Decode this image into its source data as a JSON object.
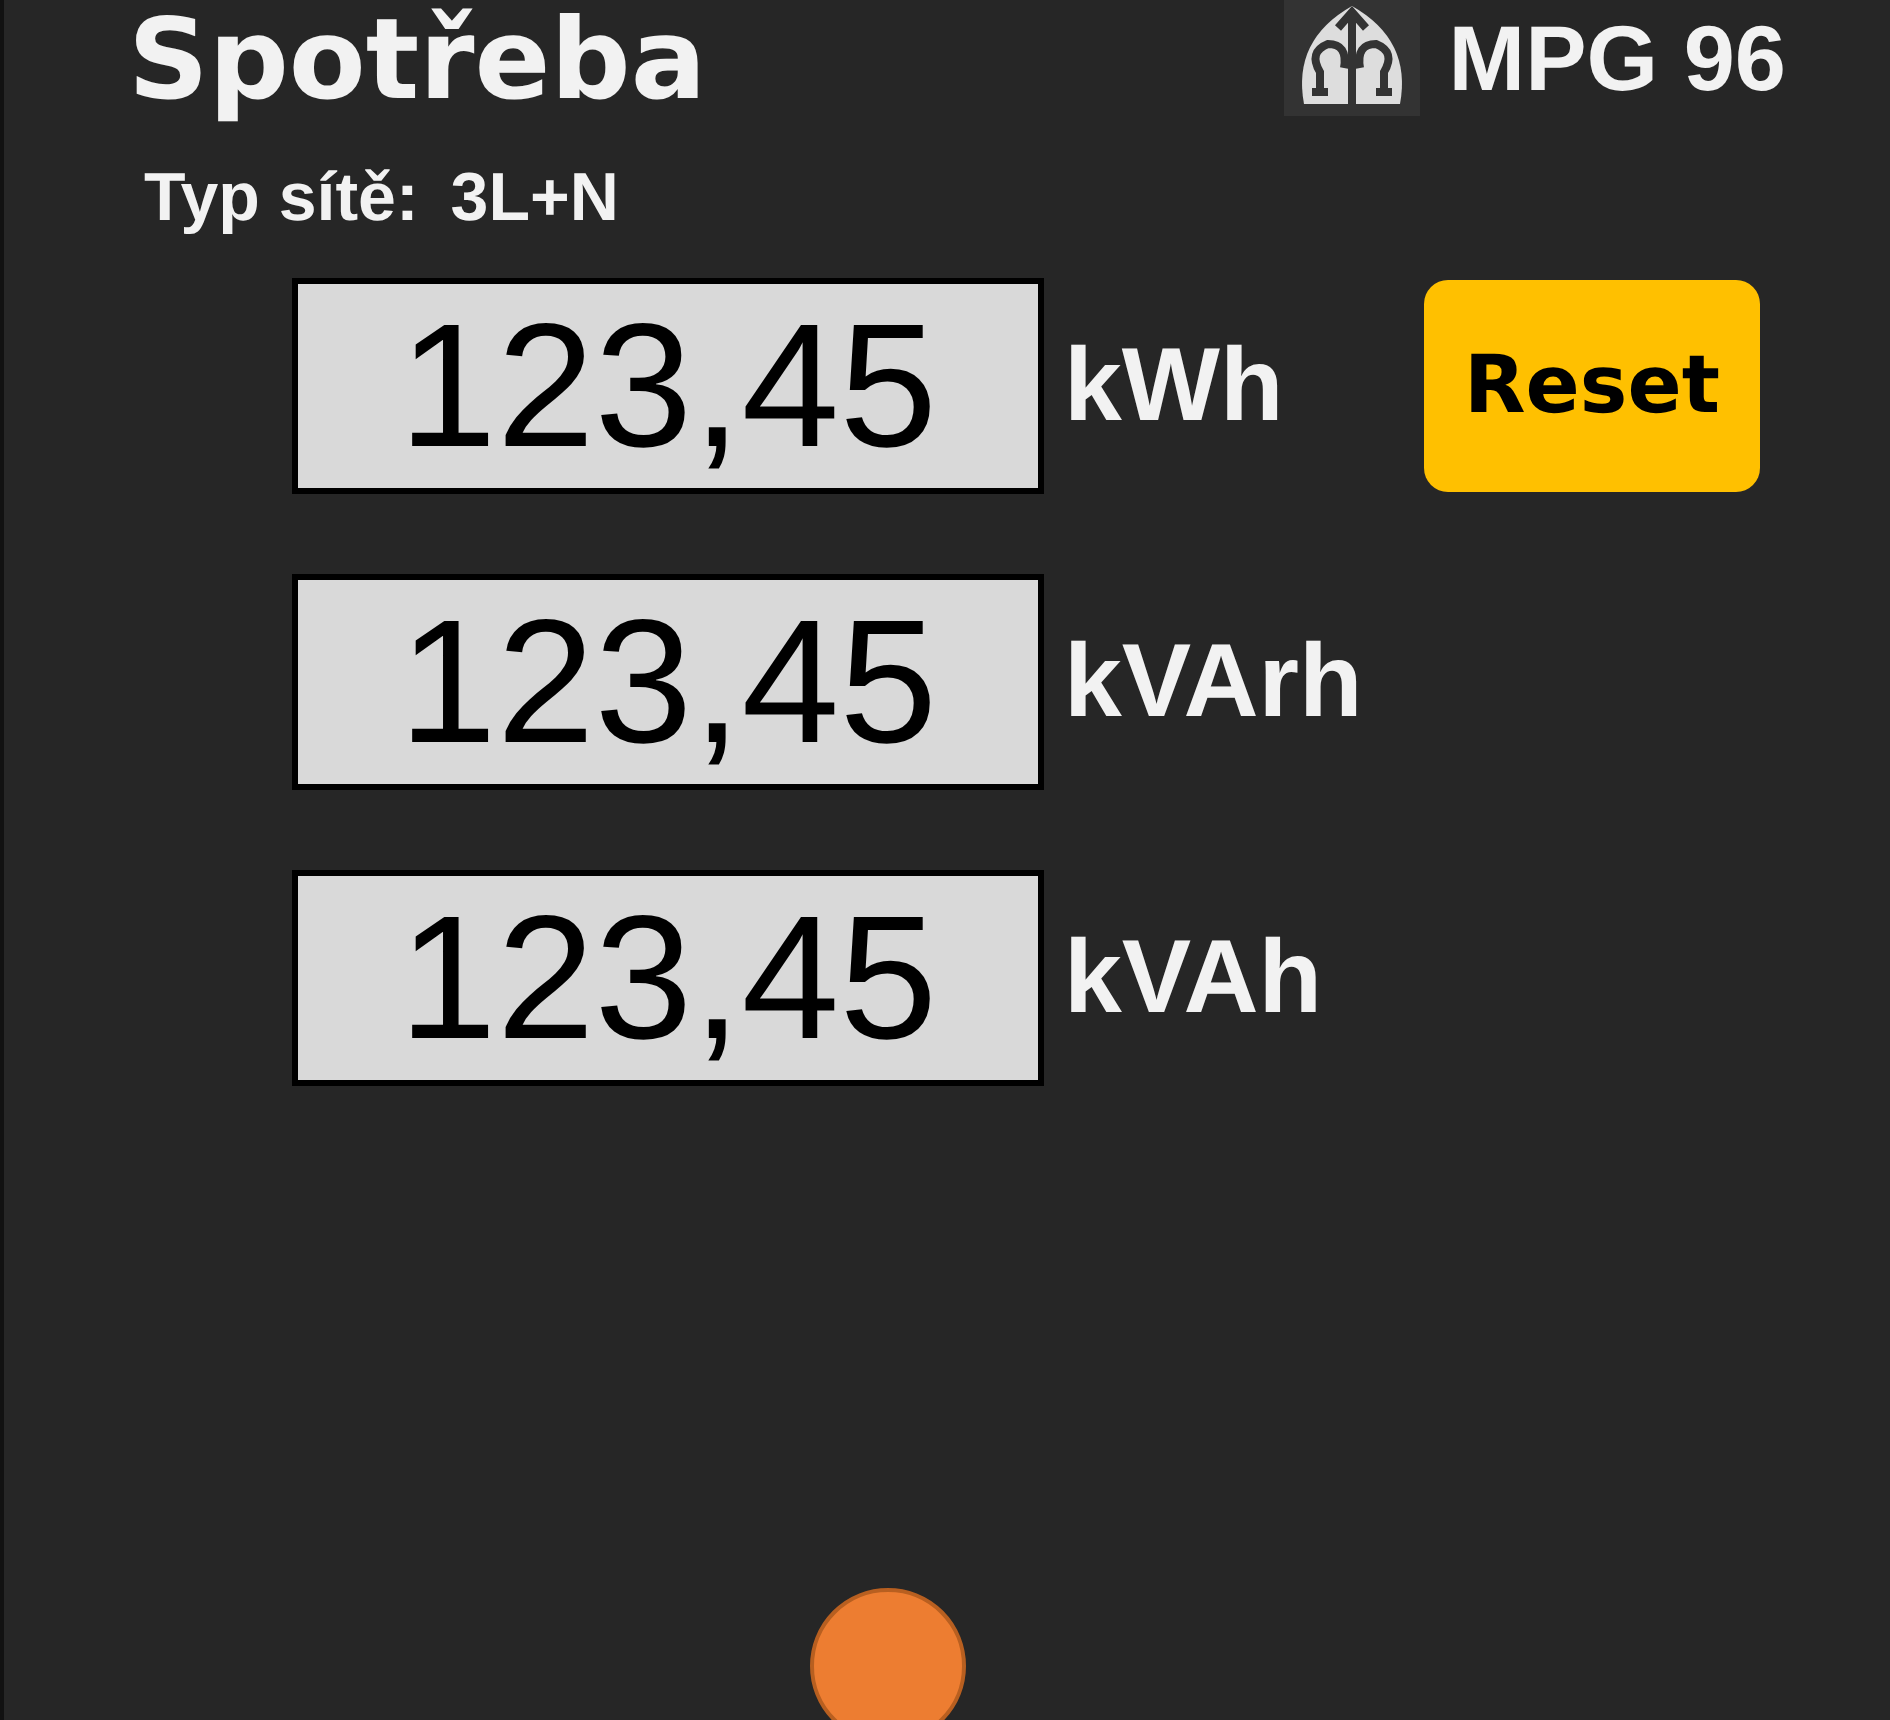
{
  "title": "Spotřeba",
  "brand": {
    "name": "MPG 96"
  },
  "network": {
    "label": "Typ sítě:",
    "value": "3L+N"
  },
  "readings": [
    {
      "value": "123,45",
      "unit": "kWh",
      "action": "Reset"
    },
    {
      "value": "123,45",
      "unit": "kVArh"
    },
    {
      "value": "123,45",
      "unit": "kVAh"
    }
  ]
}
